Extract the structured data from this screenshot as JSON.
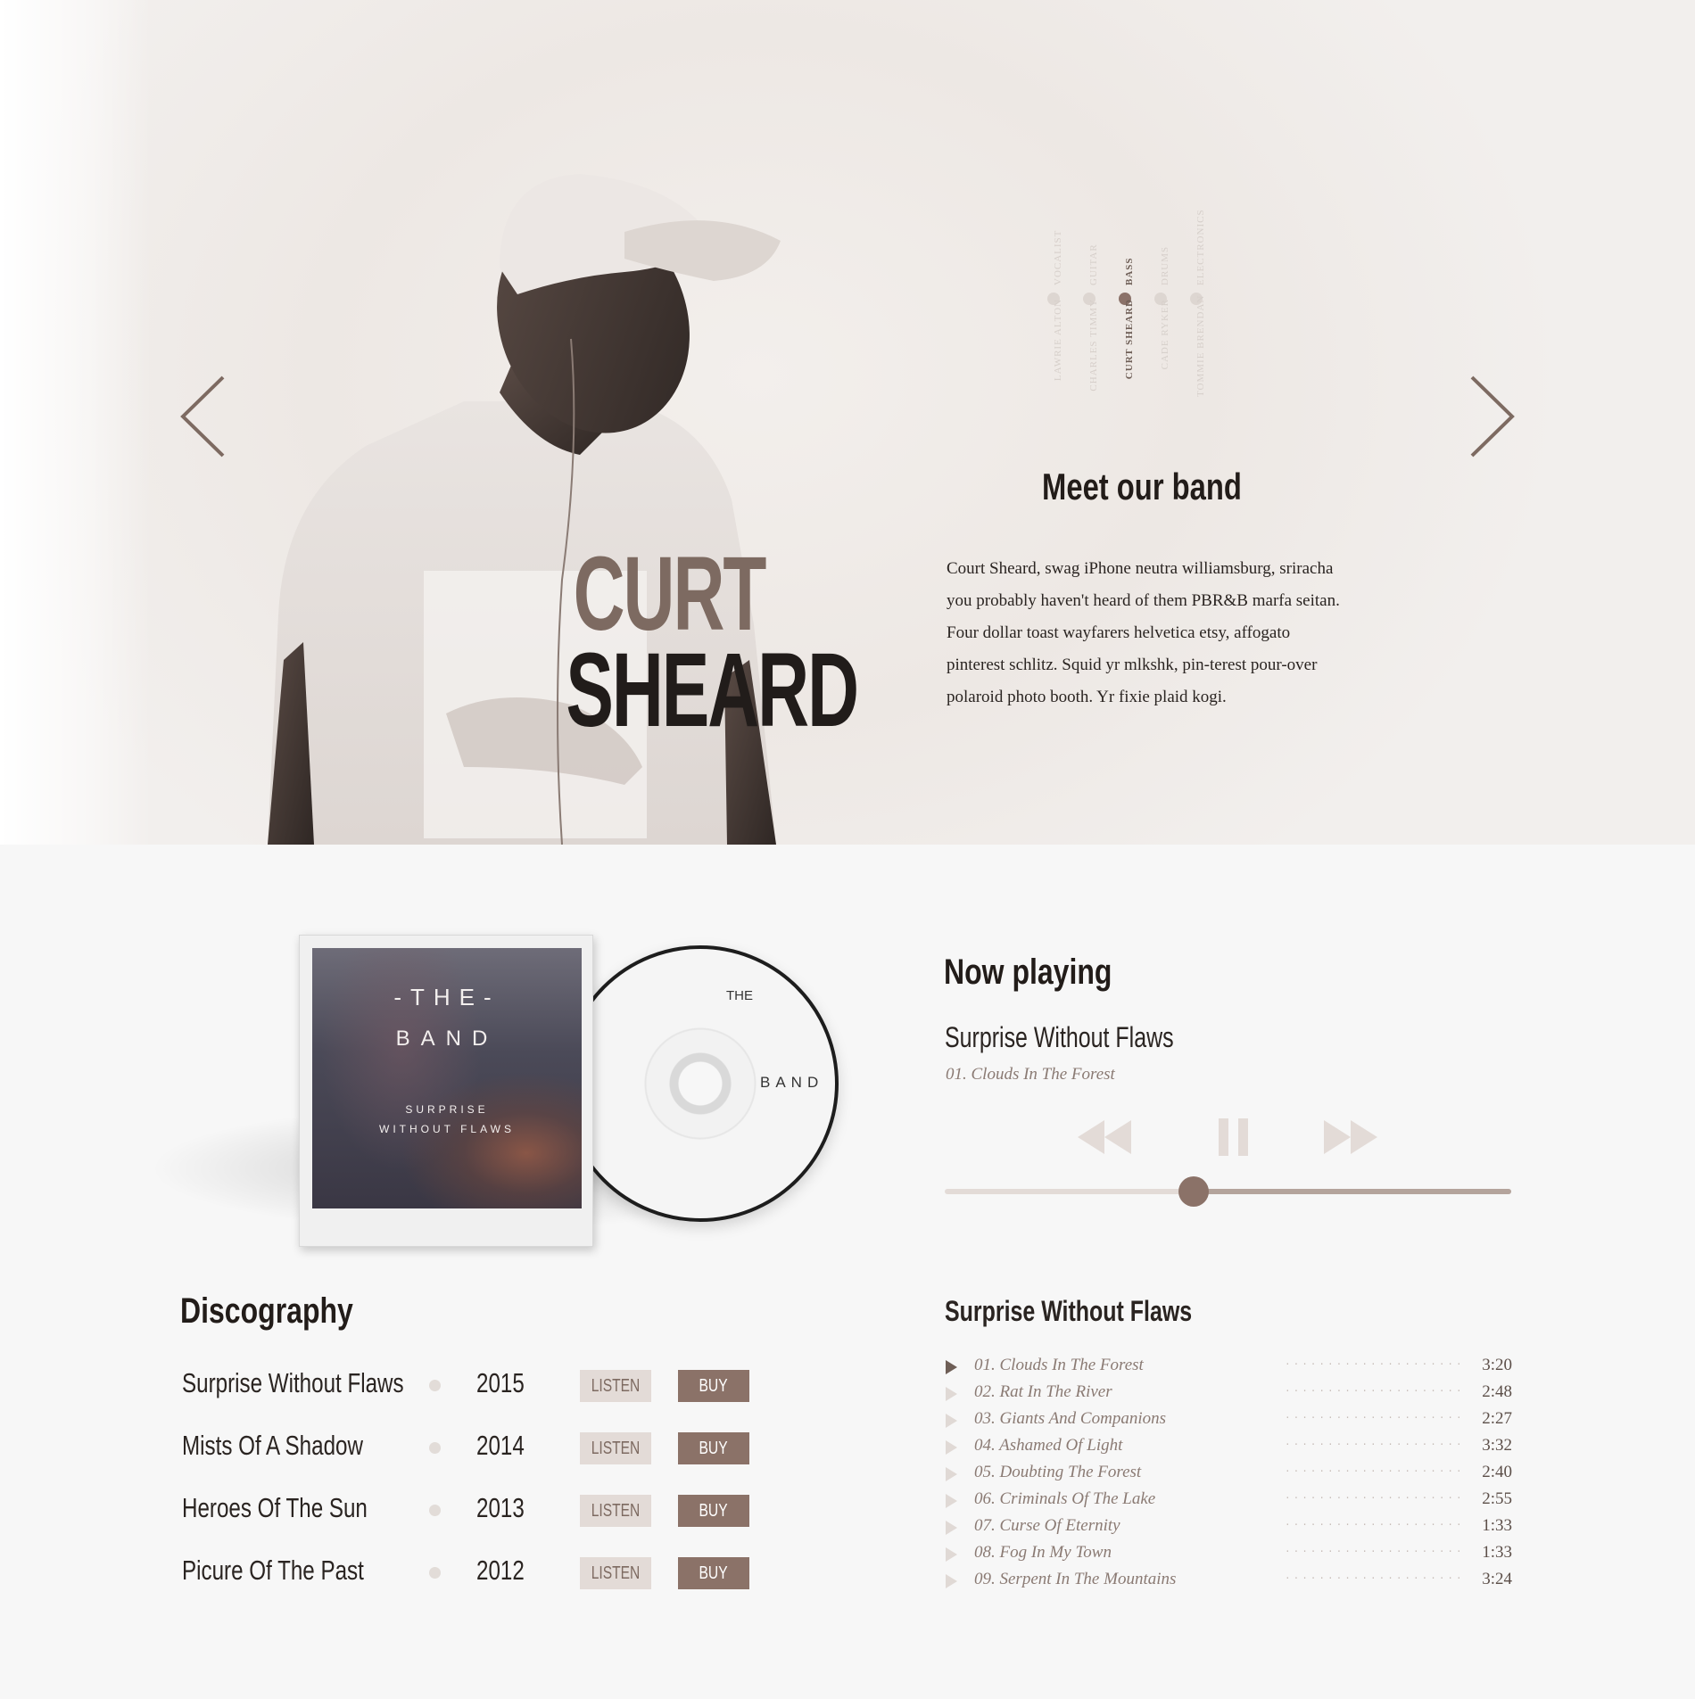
{
  "hero": {
    "member_first_name": "CURT",
    "member_last_name": "SHEARD",
    "members": [
      {
        "name": "LAWRIE ALTON",
        "role": "VOCALIST",
        "active": false
      },
      {
        "name": "CHARLES TIMMY",
        "role": "GUITAR",
        "active": false
      },
      {
        "name": "CURT SHEARD",
        "role": "BASS",
        "active": true
      },
      {
        "name": "CADE RYKER",
        "role": "DRUMS",
        "active": false
      },
      {
        "name": "TOMMIE BRENDAN",
        "role": "ELECTRONICS",
        "active": false
      }
    ],
    "section_title": "Meet our band",
    "bio": "Court Sheard, swag iPhone neutra williamsburg, sriracha you probably haven't heard of them PBR&B marfa seitan. Four dollar toast wayfarers helvetica etsy, affogato pinterest schlitz. Squid yr mlkshk, pin-terest pour-over polaroid photo booth. Yr fixie plaid kogi."
  },
  "album_art": {
    "the": "-THE-",
    "band": "BAND",
    "subtitle_line1": "SURPRISE",
    "subtitle_line2": "WITHOUT FLAWS",
    "disc_the": "THE",
    "disc_band": "BAND"
  },
  "now_playing": {
    "title": "Now playing",
    "album": "Surprise Without Flaws",
    "track": "01. Clouds In The Forest",
    "progress": 0.44,
    "icons": {
      "rewind": "rewind-icon",
      "pause": "pause-icon",
      "forward": "fast-forward-icon"
    }
  },
  "discography": {
    "title": "Discography",
    "listen_label": "LISTEN",
    "buy_label": "BUY",
    "albums": [
      {
        "name": "Surprise Without Flaws",
        "year": "2015"
      },
      {
        "name": "Mists Of A Shadow",
        "year": "2014"
      },
      {
        "name": "Heroes Of The Sun",
        "year": "2013"
      },
      {
        "name": "Picure Of The Past",
        "year": "2012"
      }
    ]
  },
  "tracklist": {
    "title": "Surprise Without Flaws",
    "leader": ".........................",
    "tracks": [
      {
        "name": "01. Clouds In The Forest",
        "time": "3:20",
        "current": true
      },
      {
        "name": "02. Rat In The River",
        "time": "2:48",
        "current": false
      },
      {
        "name": "03. Giants And Companions",
        "time": "2:27",
        "current": false
      },
      {
        "name": "04. Ashamed Of Light",
        "time": "3:32",
        "current": false
      },
      {
        "name": "05. Doubting The Forest",
        "time": "2:40",
        "current": false
      },
      {
        "name": "06. Criminals Of The Lake",
        "time": "2:55",
        "current": false
      },
      {
        "name": "07. Curse Of Eternity",
        "time": "1:33",
        "current": false
      },
      {
        "name": "08. Fog In My Town",
        "time": "1:33",
        "current": false
      },
      {
        "name": "09. Serpent In The Mountains",
        "time": "3:24",
        "current": false
      }
    ]
  },
  "colors": {
    "accent": "#8b7268",
    "accent_light": "#e3dbd7",
    "name_brown": "#7d6a61",
    "dark_text": "#221c19",
    "page_bg": "#f7f7f7"
  }
}
